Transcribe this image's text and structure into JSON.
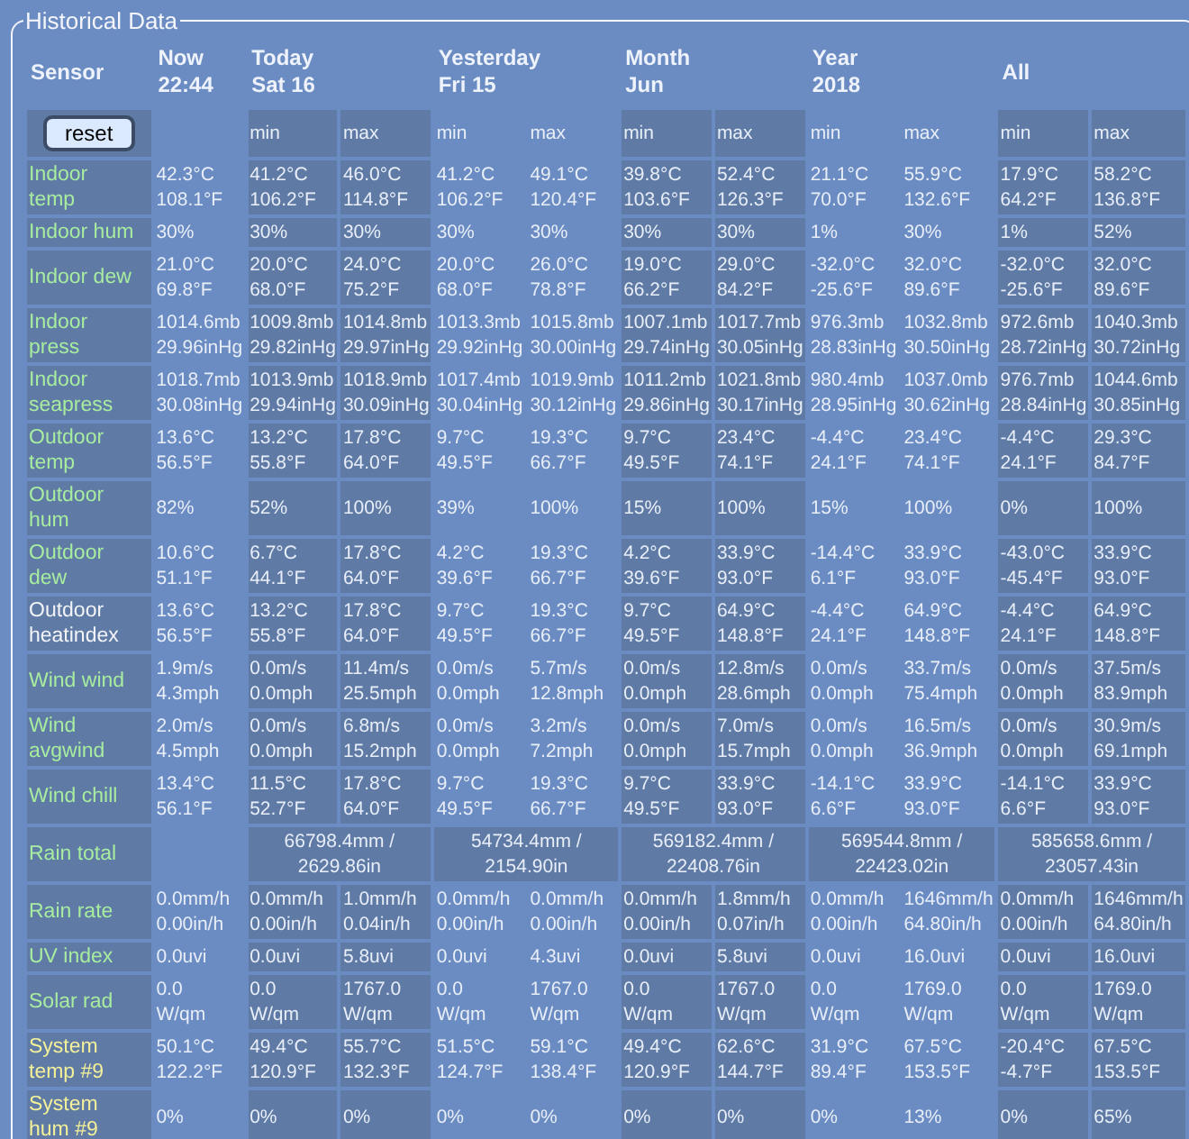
{
  "panel": {
    "title": "Historical Data"
  },
  "header": {
    "sensor": "Sensor",
    "now": {
      "title": "Now",
      "subtitle": "22:44"
    },
    "reset_button": "reset",
    "periods": [
      {
        "title": "Today",
        "subtitle": "Sat 16",
        "min": "min",
        "max": "max"
      },
      {
        "title": "Yesterday",
        "subtitle": "Fri 15",
        "min": "min",
        "max": "max"
      },
      {
        "title": "Month",
        "subtitle": "Jun",
        "min": "min",
        "max": "max"
      },
      {
        "title": "Year",
        "subtitle": "2018",
        "min": "min",
        "max": "max"
      },
      {
        "title": "All",
        "min": "min",
        "max": "max"
      }
    ]
  },
  "rows": [
    {
      "kind": "range",
      "label": [
        "Indoor",
        "temp"
      ],
      "color": "#a8eca0",
      "now": [
        "42.3°C",
        "108.1°F"
      ],
      "periods": [
        [
          [
            "41.2°C",
            "106.2°F"
          ],
          [
            "46.0°C",
            "114.8°F"
          ]
        ],
        [
          [
            "41.2°C",
            "106.2°F"
          ],
          [
            "49.1°C",
            "120.4°F"
          ]
        ],
        [
          [
            "39.8°C",
            "103.6°F"
          ],
          [
            "52.4°C",
            "126.3°F"
          ]
        ],
        [
          [
            "21.1°C",
            "70.0°F"
          ],
          [
            "55.9°C",
            "132.6°F"
          ]
        ],
        [
          [
            "17.9°C",
            "64.2°F"
          ],
          [
            "58.2°C",
            "136.8°F"
          ]
        ]
      ]
    },
    {
      "kind": "range",
      "label": [
        "Indoor hum"
      ],
      "color": "#a8eca0",
      "now": [
        "30%"
      ],
      "periods": [
        [
          [
            "30%"
          ],
          [
            "30%"
          ]
        ],
        [
          [
            "30%"
          ],
          [
            "30%"
          ]
        ],
        [
          [
            "30%"
          ],
          [
            "30%"
          ]
        ],
        [
          [
            "1%"
          ],
          [
            "30%"
          ]
        ],
        [
          [
            "1%"
          ],
          [
            "52%"
          ]
        ]
      ]
    },
    {
      "kind": "range",
      "label": [
        "Indoor dew"
      ],
      "color": "#a8eca0",
      "now": [
        "21.0°C",
        "69.8°F"
      ],
      "periods": [
        [
          [
            "20.0°C",
            "68.0°F"
          ],
          [
            "24.0°C",
            "75.2°F"
          ]
        ],
        [
          [
            "20.0°C",
            "68.0°F"
          ],
          [
            "26.0°C",
            "78.8°F"
          ]
        ],
        [
          [
            "19.0°C",
            "66.2°F"
          ],
          [
            "29.0°C",
            "84.2°F"
          ]
        ],
        [
          [
            "-32.0°C",
            "-25.6°F"
          ],
          [
            "32.0°C",
            "89.6°F"
          ]
        ],
        [
          [
            "-32.0°C",
            "-25.6°F"
          ],
          [
            "32.0°C",
            "89.6°F"
          ]
        ]
      ]
    },
    {
      "kind": "range",
      "label": [
        "Indoor",
        "press"
      ],
      "color": "#a8eca0",
      "now": [
        "1014.6mb",
        "29.96inHg"
      ],
      "periods": [
        [
          [
            "1009.8mb",
            "29.82inHg"
          ],
          [
            "1014.8mb",
            "29.97inHg"
          ]
        ],
        [
          [
            "1013.3mb",
            "29.92inHg"
          ],
          [
            "1015.8mb",
            "30.00inHg"
          ]
        ],
        [
          [
            "1007.1mb",
            "29.74inHg"
          ],
          [
            "1017.7mb",
            "30.05inHg"
          ]
        ],
        [
          [
            "976.3mb",
            "28.83inHg"
          ],
          [
            "1032.8mb",
            "30.50inHg"
          ]
        ],
        [
          [
            "972.6mb",
            "28.72inHg"
          ],
          [
            "1040.3mb",
            "30.72inHg"
          ]
        ]
      ]
    },
    {
      "kind": "range",
      "label": [
        "Indoor",
        "seapress"
      ],
      "color": "#a8eca0",
      "now": [
        "1018.7mb",
        "30.08inHg"
      ],
      "periods": [
        [
          [
            "1013.9mb",
            "29.94inHg"
          ],
          [
            "1018.9mb",
            "30.09inHg"
          ]
        ],
        [
          [
            "1017.4mb",
            "30.04inHg"
          ],
          [
            "1019.9mb",
            "30.12inHg"
          ]
        ],
        [
          [
            "1011.2mb",
            "29.86inHg"
          ],
          [
            "1021.8mb",
            "30.17inHg"
          ]
        ],
        [
          [
            "980.4mb",
            "28.95inHg"
          ],
          [
            "1037.0mb",
            "30.62inHg"
          ]
        ],
        [
          [
            "976.7mb",
            "28.84inHg"
          ],
          [
            "1044.6mb",
            "30.85inHg"
          ]
        ]
      ]
    },
    {
      "kind": "range",
      "label": [
        "Outdoor",
        "temp"
      ],
      "color": "#a8eca0",
      "now": [
        "13.6°C",
        "56.5°F"
      ],
      "periods": [
        [
          [
            "13.2°C",
            "55.8°F"
          ],
          [
            "17.8°C",
            "64.0°F"
          ]
        ],
        [
          [
            "9.7°C",
            "49.5°F"
          ],
          [
            "19.3°C",
            "66.7°F"
          ]
        ],
        [
          [
            "9.7°C",
            "49.5°F"
          ],
          [
            "23.4°C",
            "74.1°F"
          ]
        ],
        [
          [
            "-4.4°C",
            "24.1°F"
          ],
          [
            "23.4°C",
            "74.1°F"
          ]
        ],
        [
          [
            "-4.4°C",
            "24.1°F"
          ],
          [
            "29.3°C",
            "84.7°F"
          ]
        ]
      ]
    },
    {
      "kind": "range",
      "label": [
        "Outdoor",
        "hum"
      ],
      "color": "#a8eca0",
      "now": [
        "82%"
      ],
      "periods": [
        [
          [
            "52%"
          ],
          [
            "100%"
          ]
        ],
        [
          [
            "39%"
          ],
          [
            "100%"
          ]
        ],
        [
          [
            "15%"
          ],
          [
            "100%"
          ]
        ],
        [
          [
            "15%"
          ],
          [
            "100%"
          ]
        ],
        [
          [
            "0%"
          ],
          [
            "100%"
          ]
        ]
      ]
    },
    {
      "kind": "range",
      "label": [
        "Outdoor",
        "dew"
      ],
      "color": "#a8eca0",
      "now": [
        "10.6°C",
        "51.1°F"
      ],
      "periods": [
        [
          [
            "6.7°C",
            "44.1°F"
          ],
          [
            "17.8°C",
            "64.0°F"
          ]
        ],
        [
          [
            "4.2°C",
            "39.6°F"
          ],
          [
            "19.3°C",
            "66.7°F"
          ]
        ],
        [
          [
            "4.2°C",
            "39.6°F"
          ],
          [
            "33.9°C",
            "93.0°F"
          ]
        ],
        [
          [
            "-14.4°C",
            "6.1°F"
          ],
          [
            "33.9°C",
            "93.0°F"
          ]
        ],
        [
          [
            "-43.0°C",
            "-45.4°F"
          ],
          [
            "33.9°C",
            "93.0°F"
          ]
        ]
      ]
    },
    {
      "kind": "range",
      "label": [
        "Outdoor",
        "heatindex"
      ],
      "color": "#f2f4f8",
      "now": [
        "13.6°C",
        "56.5°F"
      ],
      "periods": [
        [
          [
            "13.2°C",
            "55.8°F"
          ],
          [
            "17.8°C",
            "64.0°F"
          ]
        ],
        [
          [
            "9.7°C",
            "49.5°F"
          ],
          [
            "19.3°C",
            "66.7°F"
          ]
        ],
        [
          [
            "9.7°C",
            "49.5°F"
          ],
          [
            "64.9°C",
            "148.8°F"
          ]
        ],
        [
          [
            "-4.4°C",
            "24.1°F"
          ],
          [
            "64.9°C",
            "148.8°F"
          ]
        ],
        [
          [
            "-4.4°C",
            "24.1°F"
          ],
          [
            "64.9°C",
            "148.8°F"
          ]
        ]
      ]
    },
    {
      "kind": "range",
      "label": [
        "Wind wind"
      ],
      "color": "#a8eca0",
      "now": [
        "1.9m/s",
        "4.3mph"
      ],
      "periods": [
        [
          [
            "0.0m/s",
            "0.0mph"
          ],
          [
            "11.4m/s",
            "25.5mph"
          ]
        ],
        [
          [
            "0.0m/s",
            "0.0mph"
          ],
          [
            "5.7m/s",
            "12.8mph"
          ]
        ],
        [
          [
            "0.0m/s",
            "0.0mph"
          ],
          [
            "12.8m/s",
            "28.6mph"
          ]
        ],
        [
          [
            "0.0m/s",
            "0.0mph"
          ],
          [
            "33.7m/s",
            "75.4mph"
          ]
        ],
        [
          [
            "0.0m/s",
            "0.0mph"
          ],
          [
            "37.5m/s",
            "83.9mph"
          ]
        ]
      ]
    },
    {
      "kind": "range",
      "label": [
        "Wind",
        "avgwind"
      ],
      "color": "#a8eca0",
      "now": [
        "2.0m/s",
        "4.5mph"
      ],
      "periods": [
        [
          [
            "0.0m/s",
            "0.0mph"
          ],
          [
            "6.8m/s",
            "15.2mph"
          ]
        ],
        [
          [
            "0.0m/s",
            "0.0mph"
          ],
          [
            "3.2m/s",
            "7.2mph"
          ]
        ],
        [
          [
            "0.0m/s",
            "0.0mph"
          ],
          [
            "7.0m/s",
            "15.7mph"
          ]
        ],
        [
          [
            "0.0m/s",
            "0.0mph"
          ],
          [
            "16.5m/s",
            "36.9mph"
          ]
        ],
        [
          [
            "0.0m/s",
            "0.0mph"
          ],
          [
            "30.9m/s",
            "69.1mph"
          ]
        ]
      ]
    },
    {
      "kind": "range",
      "label": [
        "Wind chill"
      ],
      "color": "#a8eca0",
      "now": [
        "13.4°C",
        "56.1°F"
      ],
      "periods": [
        [
          [
            "11.5°C",
            "52.7°F"
          ],
          [
            "17.8°C",
            "64.0°F"
          ]
        ],
        [
          [
            "9.7°C",
            "49.5°F"
          ],
          [
            "19.3°C",
            "66.7°F"
          ]
        ],
        [
          [
            "9.7°C",
            "49.5°F"
          ],
          [
            "33.9°C",
            "93.0°F"
          ]
        ],
        [
          [
            "-14.1°C",
            "6.6°F"
          ],
          [
            "33.9°C",
            "93.0°F"
          ]
        ],
        [
          [
            "-14.1°C",
            "6.6°F"
          ],
          [
            "33.9°C",
            "93.0°F"
          ]
        ]
      ]
    },
    {
      "kind": "total",
      "label": [
        "Rain total"
      ],
      "color": "#a8eca0",
      "totals": [
        [
          "66798.4mm /",
          "2629.86in"
        ],
        [
          "54734.4mm /",
          "2154.90in"
        ],
        [
          "569182.4mm /",
          "22408.76in"
        ],
        [
          "569544.8mm /",
          "22423.02in"
        ],
        [
          "585658.6mm /",
          "23057.43in"
        ]
      ]
    },
    {
      "kind": "range",
      "label": [
        "Rain rate"
      ],
      "color": "#a8eca0",
      "now": [
        "0.0mm/h",
        "0.00in/h"
      ],
      "periods": [
        [
          [
            "0.0mm/h",
            "0.00in/h"
          ],
          [
            "1.0mm/h",
            "0.04in/h"
          ]
        ],
        [
          [
            "0.0mm/h",
            "0.00in/h"
          ],
          [
            "0.0mm/h",
            "0.00in/h"
          ]
        ],
        [
          [
            "0.0mm/h",
            "0.00in/h"
          ],
          [
            "1.8mm/h",
            "0.07in/h"
          ]
        ],
        [
          [
            "0.0mm/h",
            "0.00in/h"
          ],
          [
            "1646mm/h",
            "64.80in/h"
          ]
        ],
        [
          [
            "0.0mm/h",
            "0.00in/h"
          ],
          [
            "1646mm/h",
            "64.80in/h"
          ]
        ]
      ]
    },
    {
      "kind": "range",
      "label": [
        "UV index"
      ],
      "color": "#a8eca0",
      "now": [
        "0.0uvi"
      ],
      "periods": [
        [
          [
            "0.0uvi"
          ],
          [
            "5.8uvi"
          ]
        ],
        [
          [
            "0.0uvi"
          ],
          [
            "4.3uvi"
          ]
        ],
        [
          [
            "0.0uvi"
          ],
          [
            "5.8uvi"
          ]
        ],
        [
          [
            "0.0uvi"
          ],
          [
            "16.0uvi"
          ]
        ],
        [
          [
            "0.0uvi"
          ],
          [
            "16.0uvi"
          ]
        ]
      ]
    },
    {
      "kind": "range",
      "label": [
        "Solar rad"
      ],
      "color": "#a8eca0",
      "now": [
        "0.0",
        "W/qm"
      ],
      "periods": [
        [
          [
            "0.0",
            "W/qm"
          ],
          [
            "1767.0",
            "W/qm"
          ]
        ],
        [
          [
            "0.0",
            "W/qm"
          ],
          [
            "1767.0",
            "W/qm"
          ]
        ],
        [
          [
            "0.0",
            "W/qm"
          ],
          [
            "1767.0",
            "W/qm"
          ]
        ],
        [
          [
            "0.0",
            "W/qm"
          ],
          [
            "1769.0",
            "W/qm"
          ]
        ],
        [
          [
            "0.0",
            "W/qm"
          ],
          [
            "1769.0",
            "W/qm"
          ]
        ]
      ]
    },
    {
      "kind": "range",
      "label": [
        "System",
        "temp #9"
      ],
      "color": "#f4f09a",
      "now": [
        "50.1°C",
        "122.2°F"
      ],
      "periods": [
        [
          [
            "49.4°C",
            "120.9°F"
          ],
          [
            "55.7°C",
            "132.3°F"
          ]
        ],
        [
          [
            "51.5°C",
            "124.7°F"
          ],
          [
            "59.1°C",
            "138.4°F"
          ]
        ],
        [
          [
            "49.4°C",
            "120.9°F"
          ],
          [
            "62.6°C",
            "144.7°F"
          ]
        ],
        [
          [
            "31.9°C",
            "89.4°F"
          ],
          [
            "67.5°C",
            "153.5°F"
          ]
        ],
        [
          [
            "-20.4°C",
            "-4.7°F"
          ],
          [
            "67.5°C",
            "153.5°F"
          ]
        ]
      ]
    },
    {
      "kind": "range",
      "label": [
        "System",
        "hum #9"
      ],
      "color": "#f4f09a",
      "now": [
        "0%"
      ],
      "periods": [
        [
          [
            "0%"
          ],
          [
            "0%"
          ]
        ],
        [
          [
            "0%"
          ],
          [
            "0%"
          ]
        ],
        [
          [
            "0%"
          ],
          [
            "0%"
          ]
        ],
        [
          [
            "0%"
          ],
          [
            "13%"
          ]
        ],
        [
          [
            "0%"
          ],
          [
            "65%"
          ]
        ]
      ]
    }
  ]
}
